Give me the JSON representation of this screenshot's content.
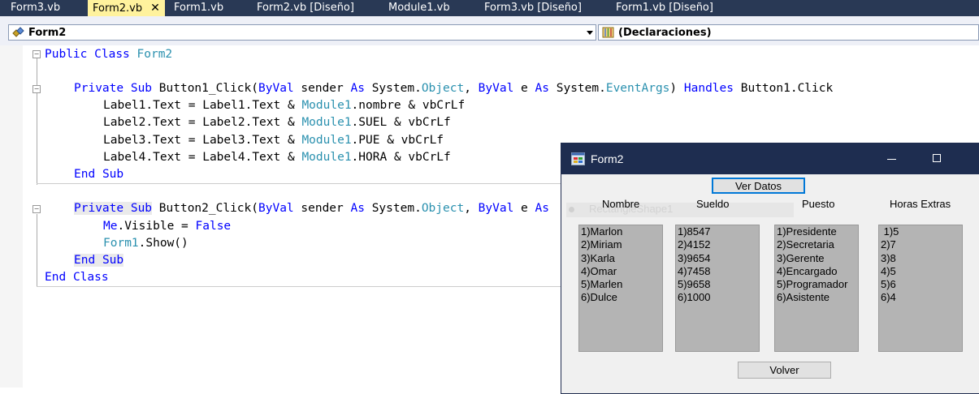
{
  "tabs": [
    {
      "label": "Form3.vb",
      "active": false
    },
    {
      "label": "Form2.vb",
      "active": true,
      "close": "✕"
    },
    {
      "label": "Form1.vb",
      "active": false
    },
    {
      "label": "Form2.vb [Diseño]",
      "active": false
    },
    {
      "label": "Module1.vb",
      "active": false
    },
    {
      "label": "Form3.vb [Diseño]",
      "active": false
    },
    {
      "label": "Form1.vb [Diseño]",
      "active": false
    }
  ],
  "toolbar": {
    "class_combo": {
      "value": "Form2",
      "icon": "class-icon"
    },
    "member_combo": {
      "value": "(Declaraciones)",
      "icon": "members-icon"
    }
  },
  "colors": {
    "keyword": "#0000ff",
    "type": "#2b91af",
    "tabbar": "#293955",
    "active_tab": "#fff29d"
  },
  "code": {
    "l1_kw1": "Public",
    "l1_kw2": "Class",
    "l1_ty": "Form2",
    "l3_kw1": "Private",
    "l3_kw2": "Sub",
    "l3_t1": " Button1_Click(",
    "l3_kw3": "ByVal",
    "l3_t2": " sender ",
    "l3_kw4": "As",
    "l3_t3": " System.",
    "l3_ty1": "Object",
    "l3_t4": ", ",
    "l3_kw5": "ByVal",
    "l3_t5": " e ",
    "l3_kw6": "As",
    "l3_t6": " System.",
    "l3_ty2": "EventArgs",
    "l3_t7": ") ",
    "l3_kw7": "Handles",
    "l3_t8": " Button1.Click",
    "l4_a": "Label1.Text = Label1.Text & ",
    "l4_ty": "Module1",
    "l4_b": ".nombre & vbCrLf",
    "l5_a": "Label2.Text = Label2.Text & ",
    "l5_ty": "Module1",
    "l5_b": ".SUEL & vbCrLf",
    "l6_a": "Label3.Text = Label3.Text & ",
    "l6_ty": "Module1",
    "l6_b": ".PUE & vbCrLf",
    "l7_a": "Label4.Text = Label4.Text & ",
    "l7_ty": "Module1",
    "l7_b": ".HORA & vbCrLf",
    "l8_kw1": "End",
    "l8_kw2": "Sub",
    "l10_kw1": "Private",
    "l10_kw2": "Sub",
    "l10_t1": " Button2_Click(",
    "l10_kw3": "ByVal",
    "l10_t2": " sender ",
    "l10_kw4": "As",
    "l10_t3": " System.",
    "l10_ty1": "Object",
    "l10_t4": ", ",
    "l10_kw5": "ByVal",
    "l10_t5": " e ",
    "l10_kw6": "As",
    "l11_kw1": "Me",
    "l11_t1": ".Visible = ",
    "l11_kw2": "False",
    "l12_ty": "Form1",
    "l12_t1": ".Show()",
    "l13_kw1": "End",
    "l13_kw2": "Sub",
    "l14_kw1": "End",
    "l14_kw2": "Class"
  },
  "form2": {
    "title": "Form2",
    "ver_datos": "Ver Datos",
    "volver": "Volver",
    "ghost_text": "RectangleShape1",
    "headers": {
      "nombre": "Nombre",
      "sueldo": "Sueldo",
      "puesto": "Puesto",
      "horas": "Horas Extras"
    },
    "nombre": [
      "1)Marlon",
      "2)Miriam",
      "3)Karla",
      "4)Omar",
      "5)Marlen",
      "6)Dulce"
    ],
    "sueldo": [
      "1)8547",
      "2)4152",
      "3)9654",
      "4)7458",
      "5)9658",
      "6)1000"
    ],
    "puesto": [
      "1)Presidente",
      "2)Secretaria",
      "3)Gerente",
      "4)Encargado",
      "5)Programador",
      "6)Asistente"
    ],
    "horas": [
      " 1)5",
      "2)7",
      "3)8",
      "4)5",
      "5)6",
      "6)4"
    ]
  }
}
